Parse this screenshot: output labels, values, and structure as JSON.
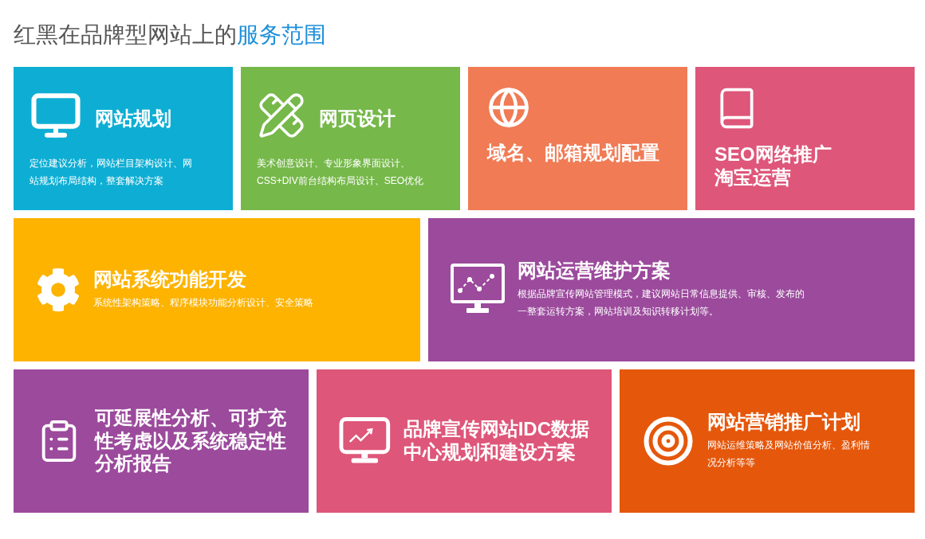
{
  "heading": {
    "text": "红黑在品牌型网站上的",
    "highlight": "服务范围"
  },
  "rows": [
    {
      "tiles": [
        {
          "kind": "inline",
          "color": "#0eaed4",
          "title": [
            "网站规划"
          ],
          "description": [
            "定位建议分析，网站栏目架构设计、网",
            "站规划布局结构，整套解决方案"
          ]
        },
        {
          "kind": "inline",
          "color": "#76b84a",
          "title": [
            "网页设计"
          ],
          "description": [
            "美术创意设计、专业形象界面设计、",
            "CSS+DIV前台结构布局设计、SEO优化"
          ]
        },
        {
          "kind": "stacked",
          "color": "#f07b55",
          "title": [
            "域名、邮箱规划配置"
          ]
        },
        {
          "kind": "stacked",
          "color": "#de5679",
          "title": [
            "SEO网络推广",
            "淘宝运营"
          ]
        }
      ]
    },
    {
      "tiles": [
        {
          "kind": "side",
          "color": "#fdb300",
          "title": [
            "网站系统功能开发"
          ],
          "description": [
            "系统性架构策略、程序模块功能分析设计、安全策略"
          ]
        },
        {
          "kind": "side",
          "color": "#9b4a9c",
          "title": [
            "网站运营维护方案"
          ],
          "description": [
            "根据品牌宣传网站管理模式，建议网站日常信息提供、审核、发布的",
            "一整套运转方案，网站培训及知识转移计划等。"
          ]
        }
      ]
    },
    {
      "tiles": [
        {
          "kind": "side",
          "color": "#9b4a9c",
          "title": [
            "可延展性分析、可扩充",
            "性考虑以及系统稳定性",
            "分析报告"
          ]
        },
        {
          "kind": "side",
          "color": "#de5679",
          "title": [
            "品牌宣传网站IDC数据",
            "中心规划和建设方案"
          ]
        },
        {
          "kind": "side",
          "color": "#e5570b",
          "title": [
            "网站营销推广计划"
          ],
          "description": [
            "网站运维策略及网站价值分析、盈利情",
            "况分析等等"
          ]
        }
      ]
    }
  ]
}
